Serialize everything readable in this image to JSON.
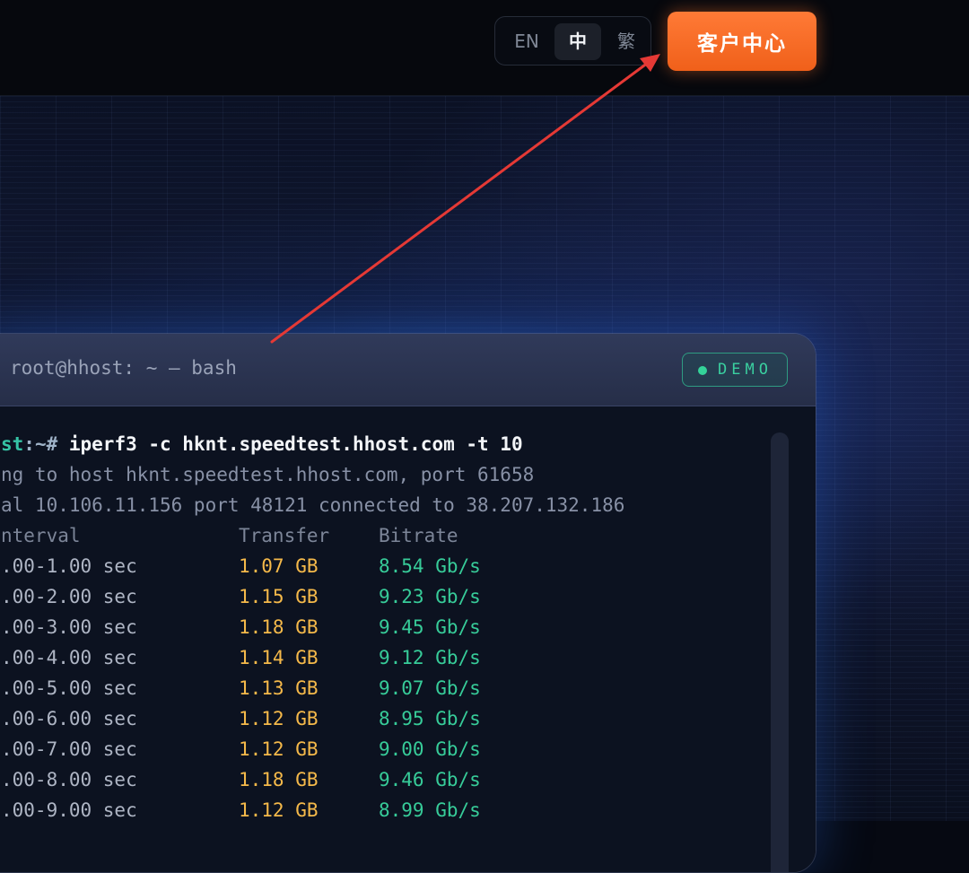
{
  "header": {
    "languages": [
      {
        "label": "EN",
        "active": false
      },
      {
        "label": "中",
        "active": true
      },
      {
        "label": "繁",
        "active": false
      }
    ],
    "client_center_label": "客户中心",
    "client_center_color": "#f26a22"
  },
  "terminal": {
    "title": "root@hhost: ~ — bash",
    "badge": "DEMO",
    "prompt_host": "st",
    "prompt_sep": ":~# ",
    "command": "iperf3 -c hknt.speedtest.hhost.com -t 10",
    "connecting_line": "ng to host hknt.speedtest.hhost.com, port 61658",
    "local_line": "al 10.106.11.156 port 48121 connected to 38.207.132.186",
    "headers": {
      "interval": "nterval",
      "transfer": "Transfer",
      "bitrate": "Bitrate"
    },
    "rows": [
      {
        "interval": ".00-1.00 sec",
        "transfer": "1.07 GB",
        "bitrate": "8.54 Gb/s"
      },
      {
        "interval": ".00-2.00 sec",
        "transfer": "1.15 GB",
        "bitrate": "9.23 Gb/s"
      },
      {
        "interval": ".00-3.00 sec",
        "transfer": "1.18 GB",
        "bitrate": "9.45 Gb/s"
      },
      {
        "interval": ".00-4.00 sec",
        "transfer": "1.14 GB",
        "bitrate": "9.12 Gb/s"
      },
      {
        "interval": ".00-5.00 sec",
        "transfer": "1.13 GB",
        "bitrate": "9.07 Gb/s"
      },
      {
        "interval": ".00-6.00 sec",
        "transfer": "1.12 GB",
        "bitrate": "8.95 Gb/s"
      },
      {
        "interval": ".00-7.00 sec",
        "transfer": "1.12 GB",
        "bitrate": "9.00 Gb/s"
      },
      {
        "interval": ".00-8.00 sec",
        "transfer": "1.18 GB",
        "bitrate": "9.46 Gb/s"
      },
      {
        "interval": ".00-9.00 sec",
        "transfer": "1.12 GB",
        "bitrate": "8.99 Gb/s"
      }
    ]
  },
  "colors": {
    "accent_orange": "#f26a22",
    "terminal_green": "#37cc99",
    "terminal_yellow": "#f5b94a",
    "annotation_arrow": "#e53935"
  }
}
